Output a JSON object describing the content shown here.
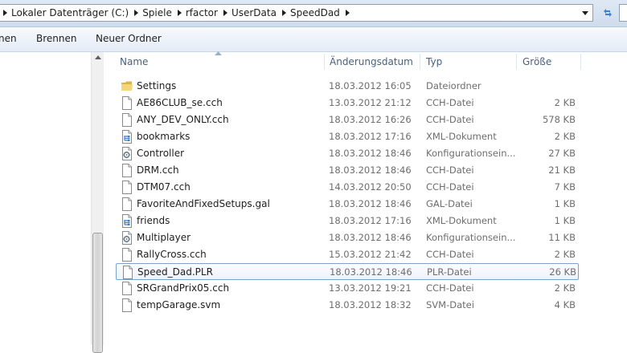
{
  "address": {
    "crumbs": [
      "Lokaler Datenträger (C:)",
      "Spiele",
      "rfactor",
      "UserData",
      "SpeedDad"
    ]
  },
  "toolbar": {
    "organize_fragment": "nen",
    "burn": "Brennen",
    "new_folder": "Neuer Ordner"
  },
  "columns": {
    "name": "Name",
    "date": "Änderungsdatum",
    "type": "Typ",
    "size": "Größe"
  },
  "files": [
    {
      "name": "Settings",
      "date": "18.03.2012 16:05",
      "type": "Dateiordner",
      "size": "",
      "icon": "folder-icon"
    },
    {
      "name": "AE86CLUB_se.cch",
      "date": "13.03.2012 21:12",
      "type": "CCH-Datei",
      "size": "2 KB",
      "icon": "file-icon"
    },
    {
      "name": "ANY_DEV_ONLY.cch",
      "date": "18.03.2012 16:26",
      "type": "CCH-Datei",
      "size": "578 KB",
      "icon": "file-icon"
    },
    {
      "name": "bookmarks",
      "date": "18.03.2012 17:16",
      "type": "XML-Dokument",
      "size": "2 KB",
      "icon": "xml-file-icon"
    },
    {
      "name": "Controller",
      "date": "18.03.2012 18:46",
      "type": "Konfigurationsein...",
      "size": "27 KB",
      "icon": "config-file-icon"
    },
    {
      "name": "DRM.cch",
      "date": "18.03.2012 18:46",
      "type": "CCH-Datei",
      "size": "21 KB",
      "icon": "file-icon"
    },
    {
      "name": "DTM07.cch",
      "date": "14.03.2012 20:50",
      "type": "CCH-Datei",
      "size": "7 KB",
      "icon": "file-icon"
    },
    {
      "name": "FavoriteAndFixedSetups.gal",
      "date": "18.03.2012 18:46",
      "type": "GAL-Datei",
      "size": "1 KB",
      "icon": "file-icon"
    },
    {
      "name": "friends",
      "date": "18.03.2012 17:16",
      "type": "XML-Dokument",
      "size": "1 KB",
      "icon": "xml-file-icon"
    },
    {
      "name": "Multiplayer",
      "date": "18.03.2012 18:46",
      "type": "Konfigurationsein...",
      "size": "11 KB",
      "icon": "config-file-icon"
    },
    {
      "name": "RallyCross.cch",
      "date": "15.03.2012 21:42",
      "type": "CCH-Datei",
      "size": "2 KB",
      "icon": "file-icon"
    },
    {
      "name": "Speed_Dad.PLR",
      "date": "18.03.2012 18:46",
      "type": "PLR-Datei",
      "size": "26 KB",
      "icon": "file-icon",
      "selected": true
    },
    {
      "name": "SRGrandPrix05.cch",
      "date": "13.03.2012 19:21",
      "type": "CCH-Datei",
      "size": "2 KB",
      "icon": "file-icon"
    },
    {
      "name": "tempGarage.svm",
      "date": "18.03.2012 18:32",
      "type": "SVM-Datei",
      "size": "4 KB",
      "icon": "file-icon"
    }
  ],
  "colors": {
    "selection_border": "#7da2ce",
    "header_text": "#4c607a",
    "folder": "#e8c45a"
  }
}
